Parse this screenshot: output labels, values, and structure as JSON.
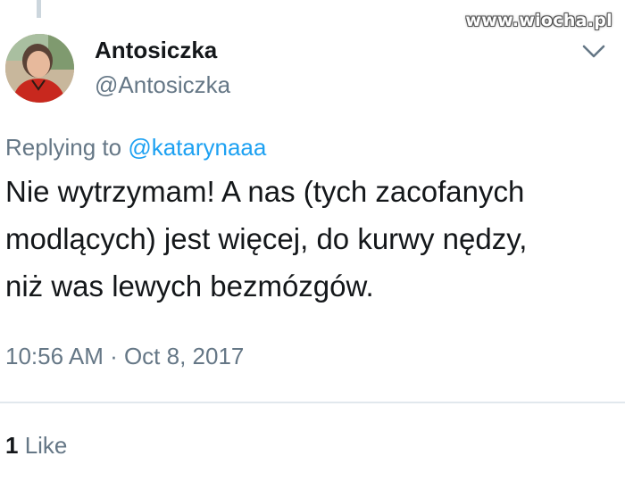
{
  "watermark": "www.wiocha.pl",
  "author": {
    "name": "Antosiczka",
    "handle": "@Antosiczka"
  },
  "reply": {
    "prefix": "Replying to ",
    "mention": "@katarynaaa"
  },
  "tweet": {
    "lines": [
      "Nie wytrzymam! A nas (tych zacofanych",
      "modlących) jest więcej, do kurwy nędzy,",
      "niż was lewych bezmózgów."
    ],
    "timestamp": "10:56 AM · Oct 8, 2017"
  },
  "stats": {
    "likes_count": "1",
    "likes_label": " Like"
  },
  "icons": {
    "menu": "chevron-down-icon",
    "avatar": "avatar"
  },
  "colors": {
    "link": "#1da1f2",
    "secondary_text": "#657786",
    "primary_text": "#14171a",
    "divider": "#e1e8ed"
  }
}
